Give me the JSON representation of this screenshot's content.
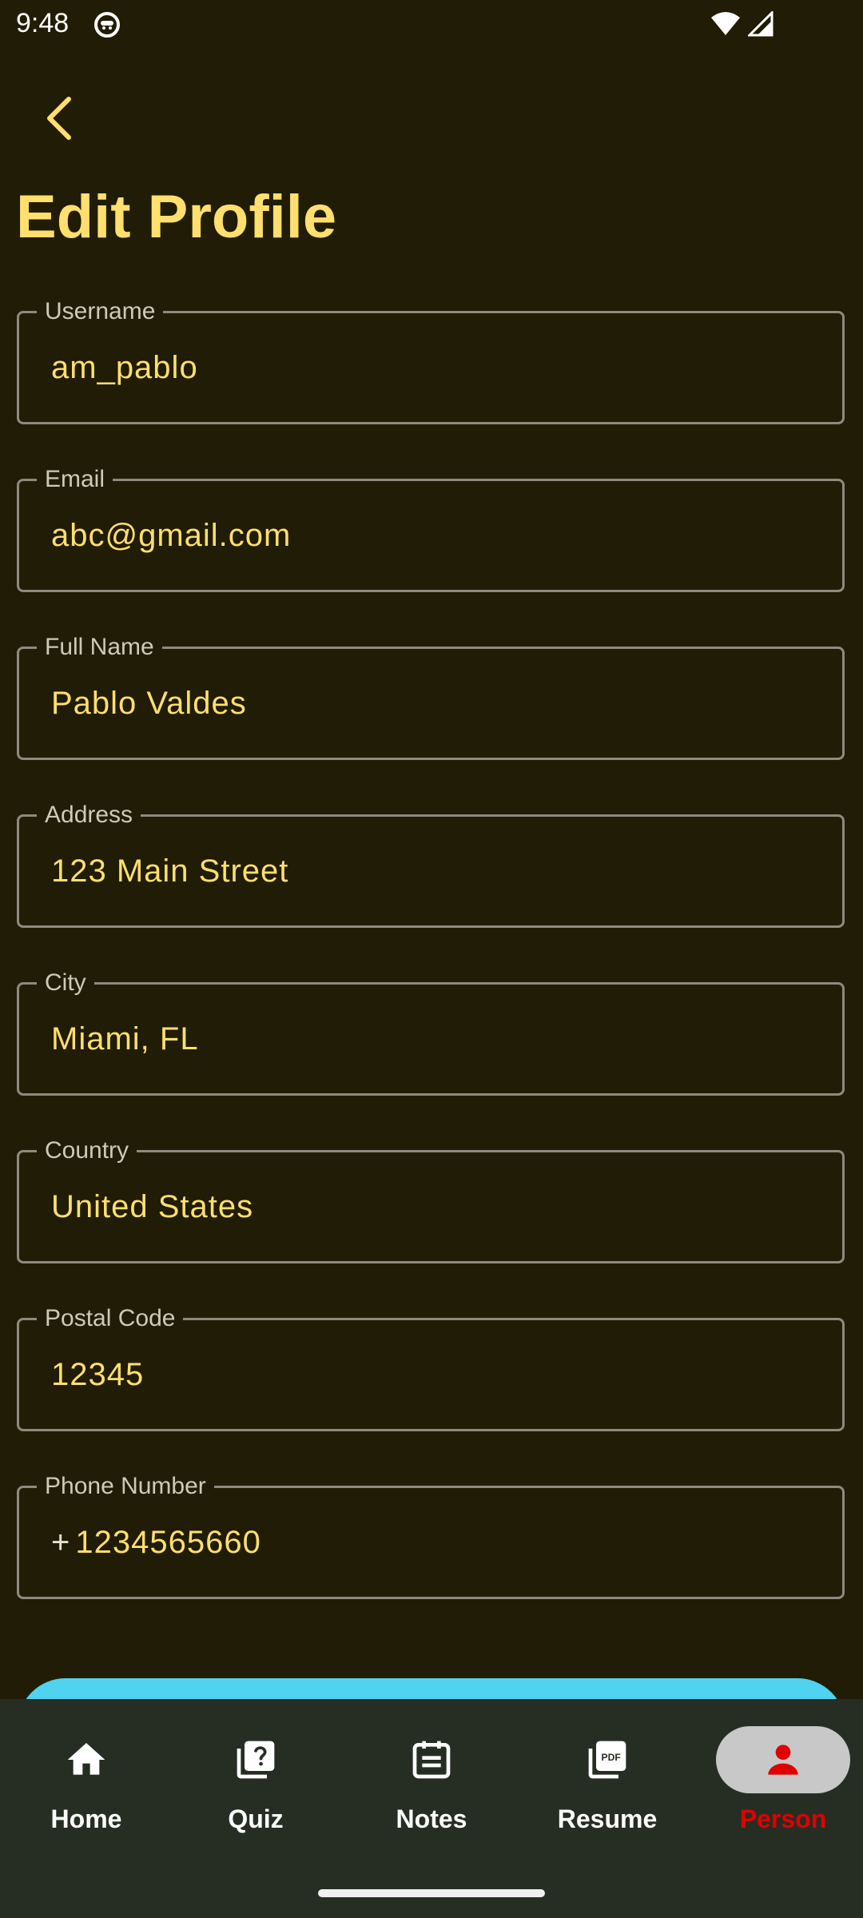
{
  "status_bar": {
    "time": "9:48"
  },
  "header": {
    "title": "Edit Profile"
  },
  "form": {
    "fields": [
      {
        "label": "Username",
        "value": "am_pablo"
      },
      {
        "label": "Email",
        "value": "abc@gmail.com"
      },
      {
        "label": "Full Name",
        "value": "Pablo Valdes"
      },
      {
        "label": "Address",
        "value": "123 Main Street"
      },
      {
        "label": "City",
        "value": "Miami, FL"
      },
      {
        "label": "Country",
        "value": "United States"
      },
      {
        "label": "Postal Code",
        "value": "12345"
      },
      {
        "label": "Phone Number",
        "prefix": "+",
        "value": "1234565660"
      }
    ]
  },
  "bottom_nav": {
    "items": [
      {
        "label": "Home",
        "icon": "home-icon"
      },
      {
        "label": "Quiz",
        "icon": "quiz-icon"
      },
      {
        "label": "Notes",
        "icon": "notes-icon"
      },
      {
        "label": "Resume",
        "icon": "pdf-icon"
      },
      {
        "label": "Person",
        "icon": "person-icon",
        "active": true
      }
    ]
  },
  "colors": {
    "background": "#211c05",
    "accent": "#ffdf6e",
    "nav_background": "#262e24",
    "active_nav": "#e00000",
    "button": "#4fd3ef"
  }
}
